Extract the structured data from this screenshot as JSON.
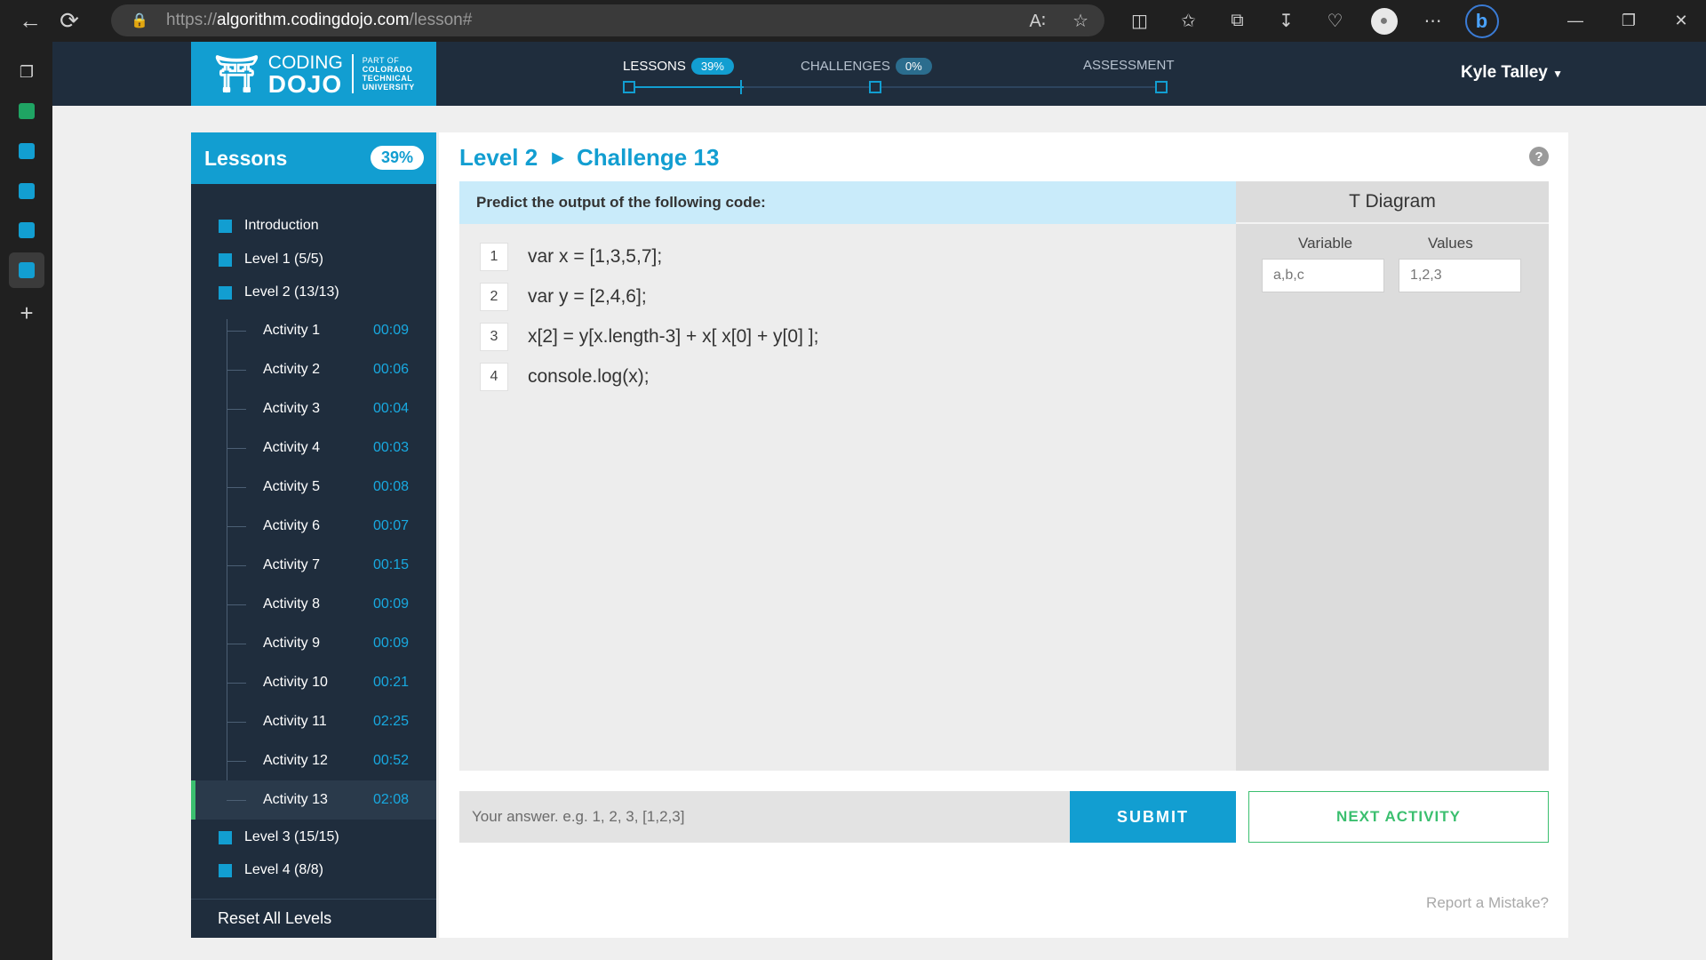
{
  "browser": {
    "url_scheme": "https://",
    "url_host": "algorithm.codingdojo.com",
    "url_path": "/lesson#"
  },
  "header": {
    "logo_word1": "CODING",
    "logo_word2": "DOJO",
    "logo_partof": [
      "PART OF",
      "COLORADO",
      "TECHNICAL",
      "UNIVERSITY"
    ],
    "progress": [
      {
        "label": "LESSONS",
        "badge": "39%"
      },
      {
        "label": "CHALLENGES",
        "badge": "0%"
      },
      {
        "label": "ASSESSMENT",
        "badge": ""
      }
    ],
    "user_name": "Kyle Talley"
  },
  "sidebar": {
    "title": "Lessons",
    "badge": "39%",
    "levels_top": [
      "Introduction",
      "Level 1 (5/5)",
      "Level 2 (13/13)"
    ],
    "activities": [
      {
        "label": "Activity 1",
        "time": "00:09"
      },
      {
        "label": "Activity 2",
        "time": "00:06"
      },
      {
        "label": "Activity 3",
        "time": "00:04"
      },
      {
        "label": "Activity 4",
        "time": "00:03"
      },
      {
        "label": "Activity 5",
        "time": "00:08"
      },
      {
        "label": "Activity 6",
        "time": "00:07"
      },
      {
        "label": "Activity 7",
        "time": "00:15"
      },
      {
        "label": "Activity 8",
        "time": "00:09"
      },
      {
        "label": "Activity 9",
        "time": "00:09"
      },
      {
        "label": "Activity 10",
        "time": "00:21"
      },
      {
        "label": "Activity 11",
        "time": "02:25"
      },
      {
        "label": "Activity 12",
        "time": "00:52"
      },
      {
        "label": "Activity 13",
        "time": "02:08"
      }
    ],
    "levels_bottom": [
      "Level 3 (15/15)",
      "Level 4 (8/8)"
    ],
    "reset_label": "Reset All Levels"
  },
  "main": {
    "crumb_level": "Level 2",
    "crumb_challenge": "Challenge 13",
    "prompt": "Predict the output of the following code:",
    "code_lines": [
      {
        "num": "1",
        "text": "var x = [1,3,5,7];"
      },
      {
        "num": "2",
        "text": "var y = [2,4,6];"
      },
      {
        "num": "3",
        "text": "x[2] = y[x.length-3] + x[ x[0] + y[0] ];"
      },
      {
        "num": "4",
        "text": "console.log(x);"
      }
    ],
    "tdiagram": {
      "title": "T Diagram",
      "col_variable": "Variable",
      "col_values": "Values",
      "variable_value": "a,b,c",
      "values_value": "1,2,3"
    },
    "answer_placeholder": "Your answer. e.g. 1, 2, 3, [1,2,3]",
    "submit_label": "SUBMIT",
    "next_label": "NEXT ACTIVITY",
    "report_label": "Report a Mistake?"
  },
  "colors": {
    "brand_blue": "#129ed1",
    "nav_dark": "#1f2d3d",
    "accent_green": "#3bbf6f"
  }
}
